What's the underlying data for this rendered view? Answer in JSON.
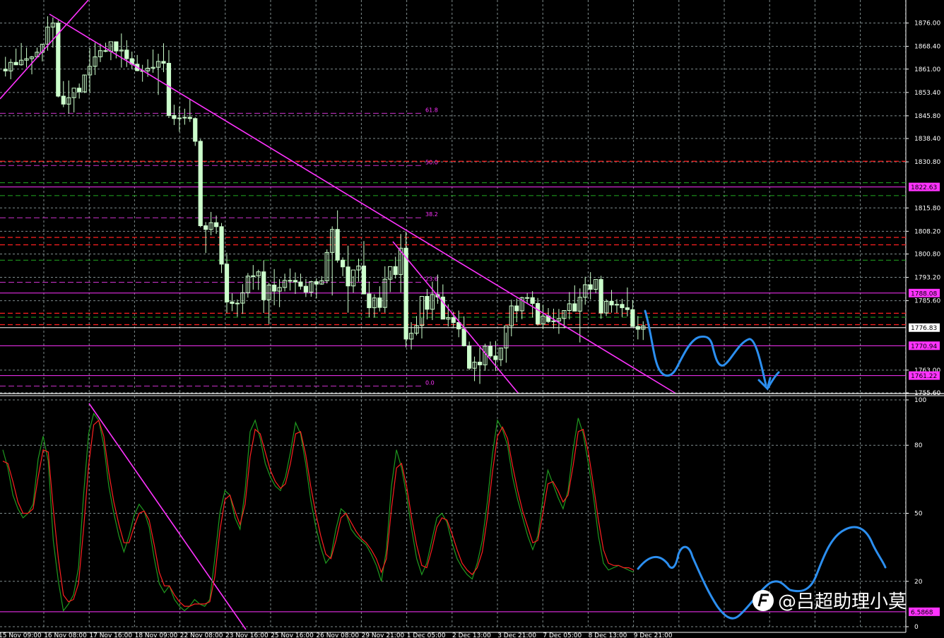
{
  "colors": {
    "background": "#000000",
    "grid": "#7f8c8d",
    "candle": "#ccffcc",
    "trendline": "#ff33ff",
    "fib": "#cc33cc",
    "hline_red": "#ff2020",
    "hline_green": "#22aa22",
    "stoch_main": "#1f9a1f",
    "stoch_signal": "#ff2020",
    "hand_drawn": "#2c8ff0",
    "axis_text": "#ffffff",
    "tag_bg": "#ff33ff"
  },
  "chart_data": [
    {
      "type": "candlestick",
      "ylim": [
        1755.6,
        1883.5
      ],
      "x_count": 144,
      "y_tick_labels": [
        "1876.00",
        "1868.40",
        "1861.00",
        "1853.40",
        "1845.80",
        "1838.40",
        "1830.80",
        "1815.80",
        "1808.20",
        "1800.80",
        "1793.20",
        "1785.60",
        "1763.00",
        "1755.60"
      ],
      "y_ticks": [
        1876.0,
        1868.4,
        1861.0,
        1853.4,
        1845.8,
        1838.4,
        1830.8,
        1815.8,
        1808.2,
        1800.8,
        1793.2,
        1785.6,
        1763.0,
        1755.6
      ],
      "price_tags": [
        {
          "label": "1822.63",
          "value": 1822.63
        },
        {
          "label": "1788.08",
          "value": 1788.08
        },
        {
          "label": "1776.83",
          "value": 1776.83,
          "style": "current"
        },
        {
          "label": "1770.94",
          "value": 1770.94
        },
        {
          "label": "1761.22",
          "value": 1761.22
        }
      ],
      "fib_levels": [
        {
          "label": "61.8",
          "value": 1846.6
        },
        {
          "label": "50.0",
          "value": 1829.6
        },
        {
          "label": "38.2",
          "value": 1812.6
        },
        {
          "label": "23.6",
          "value": 1791.6
        },
        {
          "label": "0.0",
          "value": 1757.8
        }
      ],
      "red_dashed_levels": [
        1831.0,
        1806.2,
        1803.8,
        1781.5,
        1777.8
      ],
      "green_dashed_levels": [
        1824.0,
        1819.8,
        1798.8,
        1780.2
      ],
      "candles": [
        [
          1861.0,
          1865.0,
          1858.6,
          1860.4
        ],
        [
          1860.4,
          1864.3,
          1857.7,
          1863.2
        ],
        [
          1863.2,
          1867.7,
          1862.3,
          1862.4
        ],
        [
          1862.4,
          1869.5,
          1862.1,
          1863.9
        ],
        [
          1863.9,
          1868.0,
          1861.5,
          1864.4
        ],
        [
          1864.4,
          1865.3,
          1859.3,
          1865.0
        ],
        [
          1865.0,
          1868.0,
          1864.6,
          1866.5
        ],
        [
          1866.5,
          1869.2,
          1863.5,
          1869.1
        ],
        [
          1869.1,
          1878.2,
          1867.0,
          1874.7
        ],
        [
          1874.7,
          1877.8,
          1868.0,
          1876.0
        ],
        [
          1876.0,
          1876.9,
          1851.8,
          1852.2
        ],
        [
          1852.2,
          1857.1,
          1848.6,
          1849.6
        ],
        [
          1849.6,
          1857.3,
          1846.5,
          1851.7
        ],
        [
          1851.7,
          1853.5,
          1846.9,
          1854.8
        ],
        [
          1854.8,
          1856.3,
          1851.4,
          1853.6
        ],
        [
          1853.6,
          1859.1,
          1853.2,
          1859.1
        ],
        [
          1859.1,
          1867.8,
          1853.3,
          1861.9
        ],
        [
          1861.9,
          1869.6,
          1859.1,
          1865.0
        ],
        [
          1865.0,
          1869.3,
          1863.3,
          1867.0
        ],
        [
          1867.0,
          1869.6,
          1866.5,
          1866.8
        ],
        [
          1866.8,
          1869.4,
          1863.9,
          1869.9
        ],
        [
          1869.9,
          1868.9,
          1864.5,
          1866.9
        ],
        [
          1866.9,
          1872.6,
          1861.5,
          1867.2
        ],
        [
          1867.2,
          1870.4,
          1861.7,
          1864.4
        ],
        [
          1864.4,
          1866.7,
          1861.1,
          1862.6
        ],
        [
          1862.6,
          1865.6,
          1860.3,
          1860.5
        ],
        [
          1860.5,
          1862.4,
          1856.9,
          1860.4
        ],
        [
          1860.4,
          1864.2,
          1858.5,
          1861.3
        ],
        [
          1861.3,
          1867.4,
          1859.8,
          1861.6
        ],
        [
          1861.6,
          1866.0,
          1852.6,
          1863.5
        ],
        [
          1863.5,
          1869.4,
          1860.0,
          1862.9
        ],
        [
          1862.9,
          1867.2,
          1845.1,
          1845.9
        ],
        [
          1845.9,
          1849.4,
          1842.8,
          1844.9
        ],
        [
          1844.9,
          1848.8,
          1840.6,
          1845.1
        ],
        [
          1845.1,
          1848.1,
          1842.9,
          1845.3
        ],
        [
          1845.3,
          1851.1,
          1843.8,
          1844.9
        ],
        [
          1844.9,
          1845.3,
          1836.0,
          1837.5
        ],
        [
          1837.5,
          1838.2,
          1809.5,
          1810.0
        ],
        [
          1810.0,
          1811.2,
          1801.1,
          1808.8
        ],
        [
          1808.8,
          1814.5,
          1806.9,
          1811.0
        ],
        [
          1811.0,
          1813.3,
          1807.4,
          1809.7
        ],
        [
          1809.7,
          1810.9,
          1794.6,
          1797.5
        ],
        [
          1797.5,
          1801.2,
          1781.6,
          1785.2
        ],
        [
          1785.2,
          1788.0,
          1782.2,
          1784.7
        ],
        [
          1784.7,
          1786.0,
          1780.4,
          1784.8
        ],
        [
          1784.8,
          1791.0,
          1781.3,
          1788.2
        ],
        [
          1788.2,
          1794.6,
          1786.6,
          1793.6
        ],
        [
          1793.6,
          1797.2,
          1789.2,
          1793.7
        ],
        [
          1793.7,
          1795.7,
          1789.1,
          1795.0
        ],
        [
          1795.0,
          1798.8,
          1781.6,
          1785.9
        ],
        [
          1785.9,
          1791.4,
          1778.0,
          1790.7
        ],
        [
          1790.7,
          1795.9,
          1784.1,
          1788.7
        ],
        [
          1788.7,
          1792.6,
          1783.5,
          1789.9
        ],
        [
          1789.9,
          1794.4,
          1788.6,
          1792.2
        ],
        [
          1792.2,
          1796.1,
          1788.9,
          1792.2
        ],
        [
          1792.2,
          1794.8,
          1787.8,
          1791.7
        ],
        [
          1791.7,
          1794.4,
          1789.2,
          1790.3
        ],
        [
          1790.3,
          1792.7,
          1786.8,
          1788.4
        ],
        [
          1788.4,
          1792.1,
          1786.9,
          1791.8
        ],
        [
          1791.8,
          1792.9,
          1786.4,
          1791.0
        ],
        [
          1791.0,
          1793.6,
          1790.8,
          1792.1
        ],
        [
          1792.1,
          1802.3,
          1791.2,
          1801.3
        ],
        [
          1801.3,
          1809.8,
          1787.3,
          1808.8
        ],
        [
          1808.8,
          1815.0,
          1798.0,
          1798.8
        ],
        [
          1798.8,
          1799.7,
          1793.6,
          1796.6
        ],
        [
          1796.6,
          1803.5,
          1781.7,
          1790.4
        ],
        [
          1790.4,
          1793.6,
          1788.2,
          1795.6
        ],
        [
          1795.6,
          1799.3,
          1791.8,
          1796.9
        ],
        [
          1796.9,
          1805.0,
          1788.4,
          1787.8
        ],
        [
          1787.8,
          1791.8,
          1780.2,
          1783.3
        ],
        [
          1783.3,
          1787.7,
          1780.1,
          1786.5
        ],
        [
          1786.5,
          1790.3,
          1782.1,
          1783.4
        ],
        [
          1783.4,
          1796.8,
          1781.7,
          1792.6
        ],
        [
          1792.6,
          1795.4,
          1788.4,
          1796.7
        ],
        [
          1796.7,
          1799.9,
          1792.8,
          1794.1
        ],
        [
          1794.1,
          1807.3,
          1788.3,
          1802.7
        ],
        [
          1802.7,
          1808.1,
          1770.4,
          1773.1
        ],
        [
          1773.1,
          1778.6,
          1769.7,
          1775.0
        ],
        [
          1775.0,
          1780.6,
          1774.3,
          1777.5
        ],
        [
          1777.5,
          1780.0,
          1773.3,
          1787.0
        ],
        [
          1787.0,
          1789.4,
          1779.5,
          1782.8
        ],
        [
          1782.8,
          1791.8,
          1779.3,
          1787.6
        ],
        [
          1787.6,
          1794.1,
          1784.6,
          1786.8
        ],
        [
          1786.8,
          1790.9,
          1783.3,
          1779.6
        ],
        [
          1779.6,
          1784.4,
          1777.2,
          1780.1
        ],
        [
          1780.1,
          1782.0,
          1776.6,
          1778.5
        ],
        [
          1778.5,
          1782.4,
          1773.7,
          1776.4
        ],
        [
          1776.4,
          1780.5,
          1770.7,
          1770.9
        ],
        [
          1770.9,
          1772.3,
          1763.0,
          1763.6
        ],
        [
          1763.6,
          1767.4,
          1759.4,
          1765.6
        ],
        [
          1765.6,
          1770.3,
          1758.5,
          1764.7
        ],
        [
          1764.7,
          1771.6,
          1762.8,
          1770.8
        ],
        [
          1770.8,
          1772.3,
          1766.9,
          1767.6
        ],
        [
          1767.6,
          1772.5,
          1762.7,
          1766.4
        ],
        [
          1766.4,
          1770.3,
          1764.3,
          1770.2
        ],
        [
          1770.2,
          1775.2,
          1765.4,
          1777.4
        ],
        [
          1777.4,
          1785.9,
          1774.0,
          1783.9
        ],
        [
          1783.9,
          1786.3,
          1778.6,
          1782.3
        ],
        [
          1782.3,
          1786.9,
          1779.6,
          1786.6
        ],
        [
          1786.6,
          1788.1,
          1784.7,
          1786.6
        ],
        [
          1786.6,
          1788.7,
          1780.1,
          1784.7
        ],
        [
          1784.7,
          1786.5,
          1777.5,
          1778.0
        ],
        [
          1778.0,
          1784.3,
          1776.3,
          1780.6
        ],
        [
          1780.6,
          1783.2,
          1778.3,
          1778.8
        ],
        [
          1778.8,
          1783.0,
          1776.5,
          1779.0
        ],
        [
          1779.0,
          1782.9,
          1774.8,
          1779.8
        ],
        [
          1779.8,
          1782.5,
          1776.6,
          1782.4
        ],
        [
          1782.4,
          1788.4,
          1779.5,
          1784.6
        ],
        [
          1784.6,
          1790.6,
          1783.8,
          1782.2
        ],
        [
          1782.2,
          1789.6,
          1772.0,
          1786.7
        ],
        [
          1786.7,
          1793.4,
          1784.3,
          1790.8
        ],
        [
          1790.8,
          1794.9,
          1786.0,
          1789.3
        ],
        [
          1789.3,
          1792.3,
          1788.0,
          1792.5
        ],
        [
          1792.5,
          1793.7,
          1779.7,
          1781.6
        ],
        [
          1781.6,
          1786.1,
          1780.6,
          1785.4
        ],
        [
          1785.4,
          1789.1,
          1781.7,
          1784.2
        ],
        [
          1784.2,
          1786.1,
          1781.6,
          1784.4
        ],
        [
          1784.4,
          1786.2,
          1780.3,
          1783.3
        ],
        [
          1783.3,
          1789.9,
          1780.5,
          1782.7
        ],
        [
          1782.7,
          1785.8,
          1778.4,
          1777.2
        ],
        [
          1777.2,
          1780.6,
          1773.0,
          1776.3
        ],
        [
          1776.3,
          1778.9,
          1772.8,
          1777.4
        ]
      ]
    },
    {
      "type": "line",
      "indicator": "stochastic",
      "ylim": [
        0,
        100
      ],
      "y_tick_labels": [
        "100",
        "80",
        "50",
        "20",
        "0"
      ],
      "y_ticks": [
        100,
        80,
        50,
        20,
        0
      ],
      "level_tag": {
        "label": "6.5868",
        "value": 6.5868
      },
      "series": [
        {
          "values": [
            78,
            70,
            58,
            52,
            48,
            50,
            54,
            74,
            84,
            73,
            38,
            20,
            7,
            10,
            14,
            26,
            58,
            85,
            94,
            91,
            80,
            62,
            50,
            40,
            33,
            40,
            49,
            54,
            51,
            44,
            30,
            19,
            15,
            18,
            12,
            9,
            7,
            9,
            12,
            10,
            9,
            12,
            30,
            50,
            60,
            58,
            48,
            43,
            60,
            86,
            91,
            83,
            72,
            66,
            62,
            60,
            66,
            77,
            90,
            85,
            72,
            56,
            44,
            35,
            28,
            31,
            43,
            52,
            50,
            43,
            40,
            38,
            36,
            32,
            27,
            20,
            34,
            62,
            78,
            70,
            58,
            43,
            30,
            23,
            28,
            38,
            48,
            50,
            46,
            37,
            30,
            26,
            23,
            21,
            28,
            38,
            55,
            76,
            91,
            87,
            80,
            66,
            56,
            48,
            40,
            34,
            40,
            56,
            69,
            63,
            57,
            52,
            60,
            78,
            92,
            85,
            72,
            58,
            40,
            28,
            25,
            26,
            27,
            26,
            25,
            24
          ]
        },
        {
          "values": [
            73,
            72,
            64,
            55,
            50,
            50,
            52,
            66,
            78,
            77,
            52,
            30,
            14,
            11,
            12,
            19,
            43,
            71,
            89,
            91,
            84,
            68,
            55,
            45,
            37,
            37,
            44,
            50,
            51,
            47,
            36,
            24,
            18,
            18,
            14,
            11,
            9,
            9,
            10,
            10,
            10,
            11,
            22,
            42,
            56,
            58,
            51,
            45,
            54,
            75,
            87,
            85,
            77,
            69,
            64,
            61,
            63,
            72,
            85,
            86,
            76,
            62,
            50,
            40,
            32,
            30,
            38,
            48,
            50,
            46,
            42,
            39,
            37,
            34,
            30,
            24,
            30,
            52,
            70,
            72,
            62,
            48,
            36,
            27,
            26,
            34,
            44,
            48,
            47,
            41,
            34,
            28,
            25,
            23,
            26,
            33,
            48,
            68,
            84,
            88,
            83,
            71,
            60,
            51,
            44,
            37,
            38,
            50,
            63,
            64,
            60,
            55,
            58,
            71,
            86,
            87,
            77,
            63,
            47,
            34,
            28,
            27,
            27,
            26,
            26,
            25
          ]
        }
      ]
    }
  ],
  "x_axis_labels": [
    "15 Nov 09:00",
    "16 Nov 08:00",
    "17 Nov 16:00",
    "18 Nov 09:00",
    "22 Nov 08:00",
    "23 Nov 16:00",
    "25 Nov 16:00",
    "26 Nov 08:00",
    "29 Nov 21:00",
    "1 Dec 05:00",
    "2 Dec 13:00",
    "3 Dec 21:00",
    "7 Dec 05:00",
    "8 Dec 13:00",
    "9 Dec 21:00"
  ],
  "watermark": "@吕超助理小莫",
  "icons": {
    "watermark_logo": "brand-logo-icon"
  }
}
